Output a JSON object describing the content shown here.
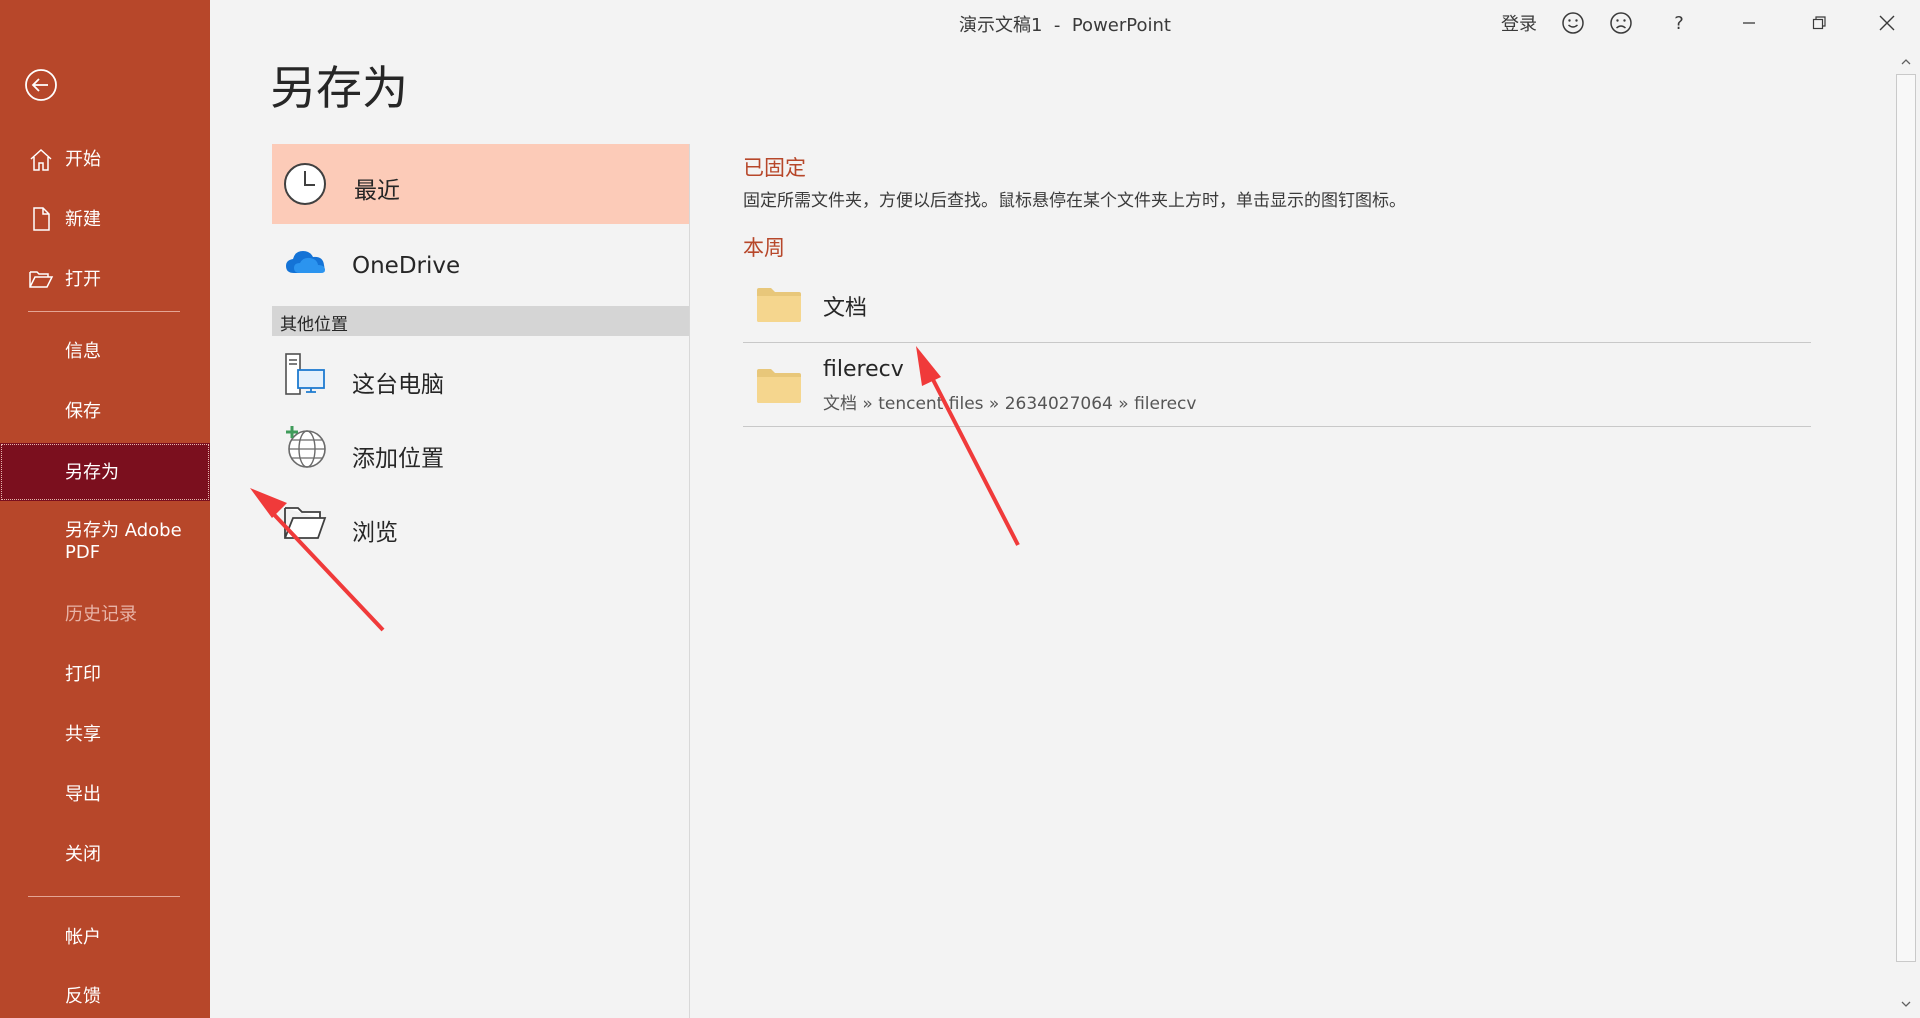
{
  "window": {
    "title": "演示文稿1  -  PowerPoint",
    "sign_in": "登录",
    "help": "?"
  },
  "nav": {
    "items": [
      {
        "label": "开始"
      },
      {
        "label": "新建"
      },
      {
        "label": "打开"
      },
      {
        "label": "信息"
      },
      {
        "label": "保存"
      },
      {
        "label": "另存为"
      },
      {
        "label": "另存为 Adobe\nPDF"
      },
      {
        "label": "历史记录"
      },
      {
        "label": "打印"
      },
      {
        "label": "共享"
      },
      {
        "label": "导出"
      },
      {
        "label": "关闭"
      },
      {
        "label": "帐户"
      },
      {
        "label": "反馈"
      }
    ]
  },
  "page": {
    "title": "另存为"
  },
  "locations": {
    "recent": "最近",
    "onedrive": "OneDrive",
    "other_header": "其他位置",
    "this_pc": "这台电脑",
    "add_place": "添加位置",
    "browse": "浏览"
  },
  "recent": {
    "pinned_title": "已固定",
    "pinned_desc": "固定所需文件夹，方便以后查找。鼠标悬停在某个文件夹上方时，单击显示的图钉图标。",
    "this_week_title": "本周",
    "folders": [
      {
        "name": "文档",
        "path": ""
      },
      {
        "name": "filerecv",
        "path": "文档 » tencent files » 2634027064 » filerecv"
      }
    ]
  },
  "colors": {
    "brand": "#b7472a",
    "selected_nav": "#7b0f1e",
    "selected_location": "#fccbb8",
    "annotation_arrow": "#f03a3a"
  }
}
